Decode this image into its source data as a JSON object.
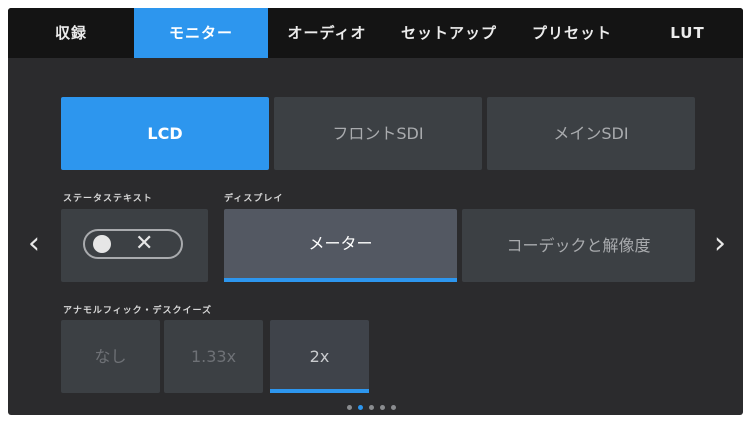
{
  "tabs": [
    {
      "label": "収録",
      "active": false
    },
    {
      "label": "モニター",
      "active": true
    },
    {
      "label": "オーディオ",
      "active": false
    },
    {
      "label": "セットアップ",
      "active": false
    },
    {
      "label": "プリセット",
      "active": false
    },
    {
      "label": "LUT",
      "active": false
    }
  ],
  "output_selector": {
    "options": [
      "LCD",
      "フロントSDI",
      "メインSDI"
    ],
    "selected": "LCD"
  },
  "status_text": {
    "label": "ステータステキスト",
    "toggle_state": "off",
    "toggle_symbol": "✕"
  },
  "display": {
    "label": "ディスプレイ",
    "options": [
      "メーター",
      "コーデックと解像度"
    ],
    "selected": "メーター"
  },
  "anamorphic_desqueeze": {
    "label": "アナモルフィック・デスクイーズ",
    "options": [
      "なし",
      "1.33x",
      "2x"
    ],
    "selected": "2x"
  },
  "navigation": {
    "prev_icon": "chevron-left-icon",
    "next_icon": "chevron-right-icon",
    "prev_glyph": "‹",
    "next_glyph": "›"
  },
  "page_indicator": {
    "total_pages": 5,
    "current_page": 2
  },
  "colors": {
    "accent": "#2d96ee",
    "background": "#2b2b2d",
    "tabbar": "#141414",
    "button": "#3c4044"
  }
}
